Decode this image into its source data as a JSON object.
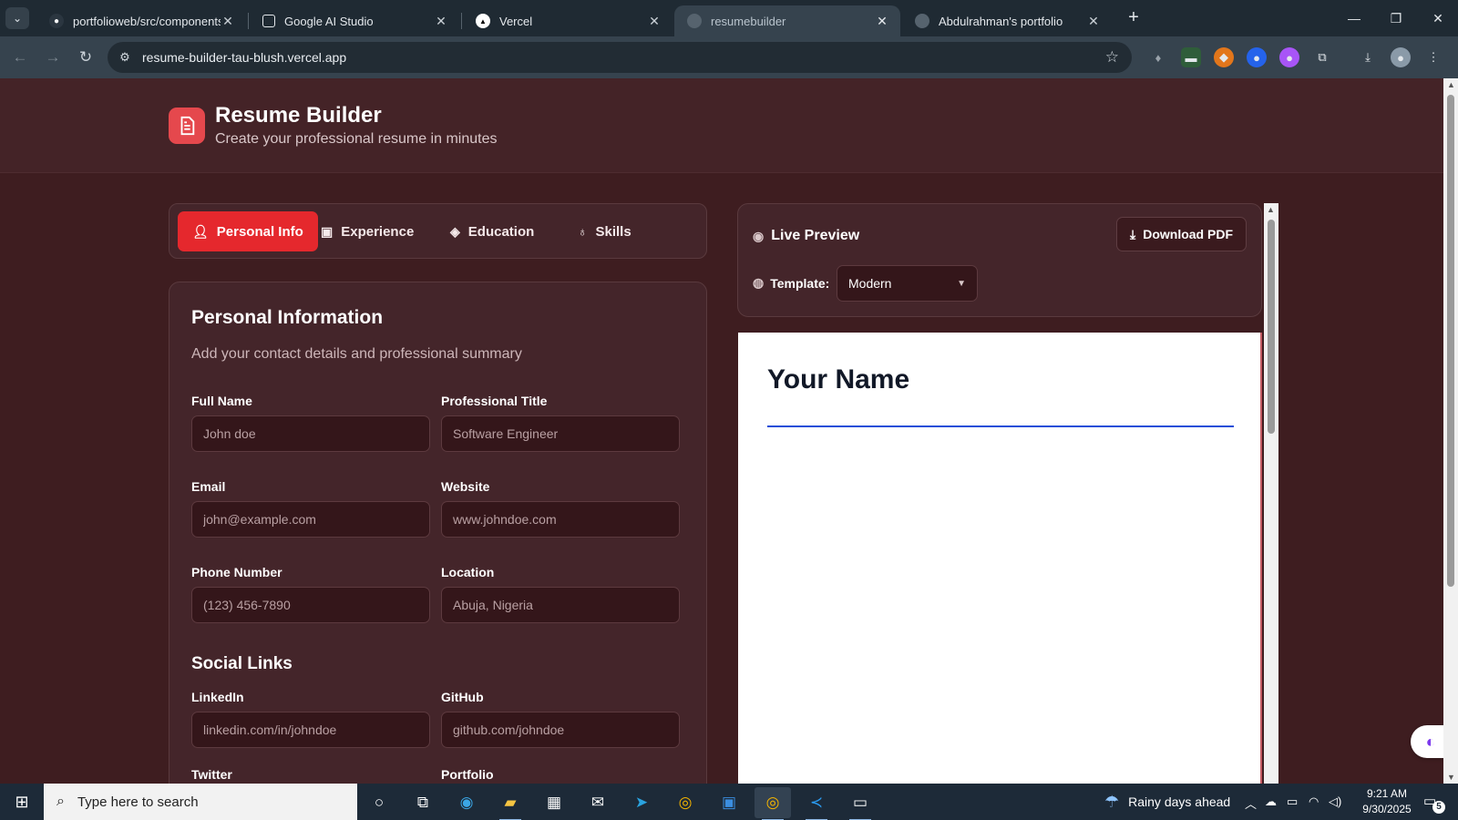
{
  "browser": {
    "tabs": [
      {
        "title": "portfolioweb/src/components a",
        "icon": "github-icon"
      },
      {
        "title": "Google AI Studio",
        "icon": "ai-studio-icon"
      },
      {
        "title": "Vercel",
        "icon": "vercel-icon"
      },
      {
        "title": "resumebuilder",
        "icon": "globe-icon"
      },
      {
        "title": "Abdulrahman's portfolio",
        "icon": "globe-icon"
      }
    ],
    "active_tab_index": 3,
    "url": "resume-builder-tau-blush.vercel.app"
  },
  "app": {
    "title": "Resume Builder",
    "subtitle": "Create your professional resume in minutes",
    "accent_color": "#e5282d"
  },
  "nav_tabs": [
    {
      "label": "Personal Info",
      "icon": "user-icon",
      "active": true
    },
    {
      "label": "Experience",
      "icon": "briefcase-icon",
      "active": false
    },
    {
      "label": "Education",
      "icon": "graduation-cap-icon",
      "active": false
    },
    {
      "label": "Skills",
      "icon": "award-icon",
      "active": false
    }
  ],
  "form": {
    "title": "Personal Information",
    "description": "Add your contact details and professional summary",
    "fields": {
      "full_name": {
        "label": "Full Name",
        "placeholder": "John doe",
        "value": ""
      },
      "professional_title": {
        "label": "Professional Title",
        "placeholder": "Software Engineer",
        "value": ""
      },
      "email": {
        "label": "Email",
        "placeholder": "john@example.com",
        "value": ""
      },
      "website": {
        "label": "Website",
        "placeholder": "www.johndoe.com",
        "value": ""
      },
      "phone": {
        "label": "Phone Number",
        "placeholder": "(123) 456-7890",
        "value": ""
      },
      "location": {
        "label": "Location",
        "placeholder": "Abuja, Nigeria",
        "value": ""
      }
    },
    "social_section_title": "Social Links",
    "social": {
      "linkedin": {
        "label": "LinkedIn",
        "placeholder": "linkedin.com/in/johndoe",
        "value": ""
      },
      "github": {
        "label": "GitHub",
        "placeholder": "github.com/johndoe",
        "value": ""
      },
      "twitter": {
        "label": "Twitter"
      },
      "portfolio": {
        "label": "Portfolio"
      }
    }
  },
  "preview": {
    "label": "Live Preview",
    "download_label": "Download PDF",
    "template_label": "Template:",
    "template_selected": "Modern",
    "resume_name": "Your Name",
    "rule_color": "#1d4ed8"
  },
  "taskbar": {
    "search_placeholder": "Type here to search",
    "weather": "Rainy days ahead",
    "time": "9:21 AM",
    "date": "9/30/2025",
    "notification_count": "5"
  }
}
